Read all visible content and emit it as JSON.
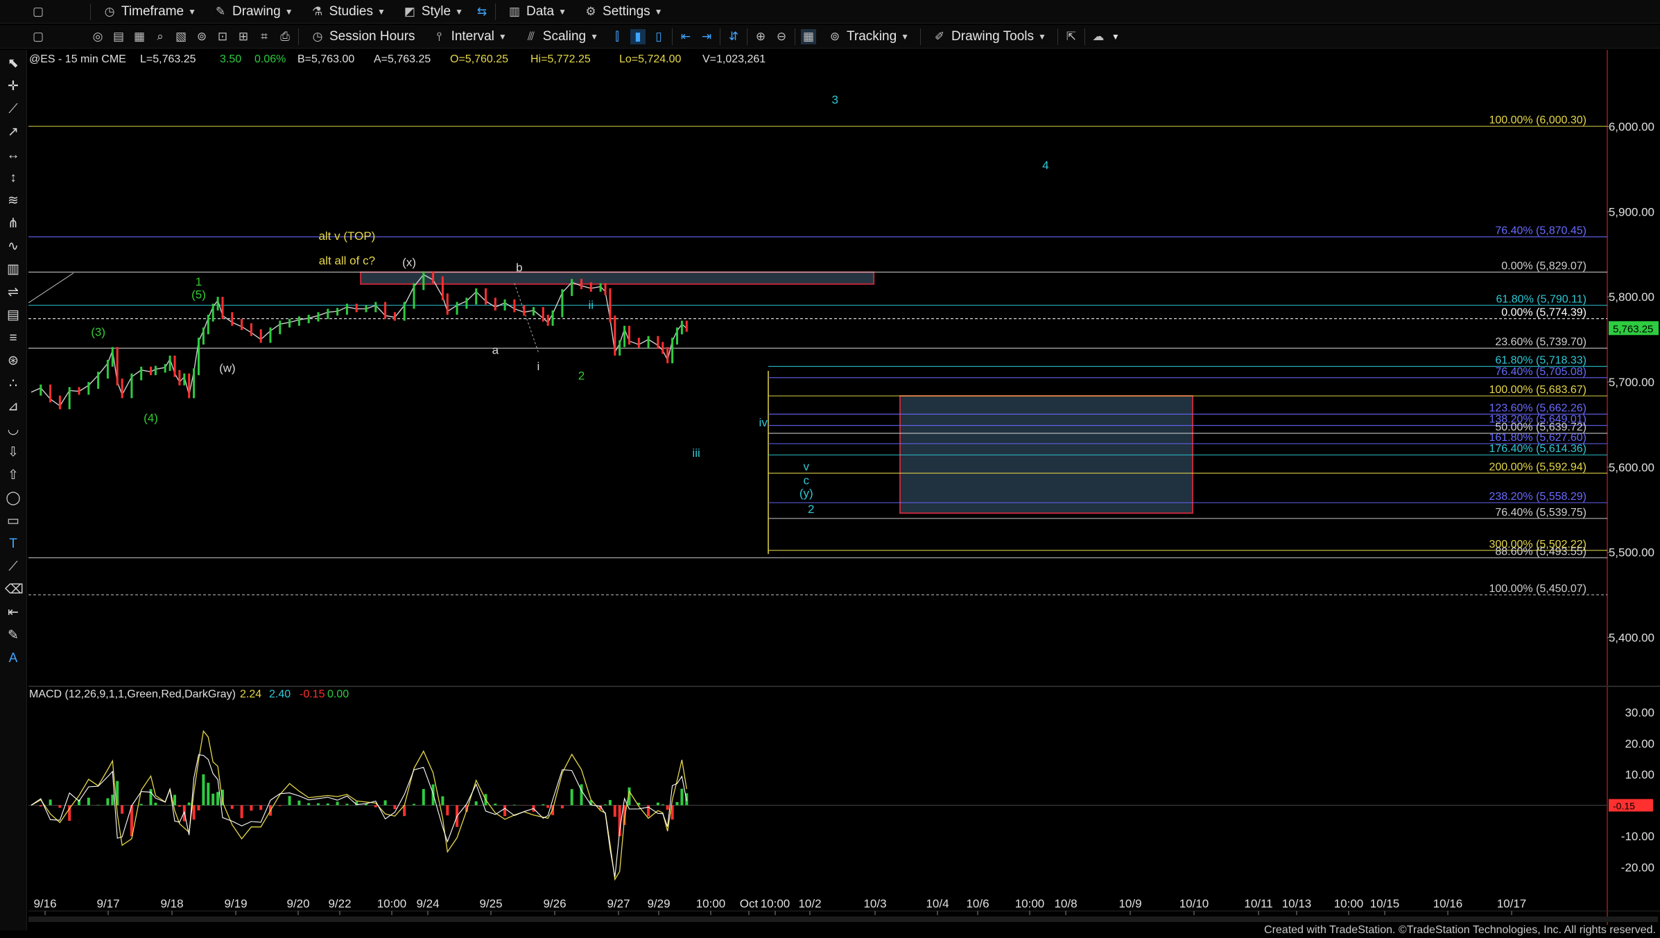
{
  "toolbar1": [
    {
      "name": "timeframe-menu",
      "icon": "clock-icon",
      "label": "Timeframe"
    },
    {
      "name": "drawing-menu",
      "icon": "pencil-icon",
      "label": "Drawing"
    },
    {
      "name": "studies-menu",
      "icon": "flask-icon",
      "label": "Studies"
    },
    {
      "name": "style-menu",
      "icon": "style-icon",
      "label": "Style"
    },
    {
      "name": "data-menu",
      "icon": "chart-icon",
      "label": "Data"
    },
    {
      "name": "settings-menu",
      "icon": "gear-icon",
      "label": "Settings"
    }
  ],
  "toolbar2": {
    "session_label": "Session Hours",
    "interval_label": "Interval",
    "scaling_label": "Scaling",
    "tracking_label": "Tracking",
    "drawing_tools_label": "Drawing Tools"
  },
  "quote_line": {
    "symbol": "@ES - 15 min  CME",
    "last": "L=5,763.25",
    "chg": "3.50",
    "pct": "0.06%",
    "bid": "B=5,763.00",
    "ask": "A=5,763.25",
    "open": "O=5,760.25",
    "high": "Hi=5,772.25",
    "low": "Lo=5,724.00",
    "vol": "V=1,023,261"
  },
  "macd_label": {
    "name": "MACD (12,26,9,1,1,Green,Red,DarkGray)",
    "v1": "2.24",
    "v2": "2.40",
    "v3": "-0.15",
    "v4": "0.00"
  },
  "footer_text": "Created with TradeStation. ©TradeStation Technologies, Inc. All rights reserved.",
  "colors": {
    "up": "#2ecc40",
    "down": "#ff3030",
    "yellow": "#e6d84a",
    "cyan": "#2fc9d6",
    "blue": "#6a6aff",
    "green_label": "#33cc33",
    "white_label": "#d8d8d8"
  },
  "chart_data": {
    "type": "line",
    "symbol": "@ES",
    "interval": "15 min",
    "price_ticks": [
      "6,000.00",
      "5,900.00",
      "5,800.00",
      "5,700.00",
      "5,600.00",
      "5,500.00",
      "5,400.00"
    ],
    "price_tick_values": [
      6000,
      5900,
      5800,
      5700,
      5600,
      5500,
      5400
    ],
    "ylim": [
      5345,
      6090
    ],
    "last_price_badge": "5,763.25",
    "time_ticks": [
      "9/16",
      "9/17",
      "9/18",
      "9/19",
      "9/20",
      "9/22",
      "10:00",
      "9/24",
      "9/25",
      "9/26",
      "9/27",
      "9/29",
      "10:00",
      "Oct",
      "10:00",
      "10/2",
      "10/3",
      "10/4",
      "10/6",
      "10:00",
      "10/8",
      "10/9",
      "10/10",
      "10/11",
      "10/13",
      "10:00",
      "10/15",
      "10/16",
      "10/17"
    ],
    "price_path": [
      [
        0,
        5688
      ],
      [
        2,
        5693
      ],
      [
        4,
        5680
      ],
      [
        6,
        5672
      ],
      [
        8,
        5690
      ],
      [
        10,
        5689
      ],
      [
        12,
        5696
      ],
      [
        14,
        5708
      ],
      [
        16,
        5722
      ],
      [
        17,
        5737
      ],
      [
        18,
        5700
      ],
      [
        19,
        5685
      ],
      [
        21,
        5706
      ],
      [
        23,
        5714
      ],
      [
        25,
        5712
      ],
      [
        26,
        5715
      ],
      [
        28,
        5717
      ],
      [
        29,
        5727
      ],
      [
        30,
        5710
      ],
      [
        31,
        5700
      ],
      [
        32,
        5706
      ],
      [
        33,
        5685
      ],
      [
        34,
        5712
      ],
      [
        35,
        5748
      ],
      [
        36,
        5760
      ],
      [
        37,
        5775
      ],
      [
        38,
        5788
      ],
      [
        39,
        5796
      ],
      [
        40,
        5778
      ],
      [
        42,
        5770
      ],
      [
        44,
        5765
      ],
      [
        46,
        5758
      ],
      [
        48,
        5750
      ],
      [
        50,
        5760
      ],
      [
        52,
        5768
      ],
      [
        54,
        5770
      ],
      [
        56,
        5773
      ],
      [
        58,
        5775
      ],
      [
        60,
        5778
      ],
      [
        62,
        5782
      ],
      [
        64,
        5783
      ],
      [
        66,
        5788
      ],
      [
        68,
        5786
      ],
      [
        70,
        5786
      ],
      [
        72,
        5790
      ],
      [
        74,
        5778
      ],
      [
        76,
        5776
      ],
      [
        78,
        5790
      ],
      [
        80,
        5812
      ],
      [
        82,
        5826
      ],
      [
        84,
        5820
      ],
      [
        86,
        5800
      ],
      [
        87,
        5783
      ],
      [
        89,
        5790
      ],
      [
        91,
        5795
      ],
      [
        93,
        5806
      ],
      [
        95,
        5795
      ],
      [
        97,
        5788
      ],
      [
        99,
        5793
      ],
      [
        101,
        5786
      ],
      [
        103,
        5782
      ],
      [
        105,
        5784
      ],
      [
        107,
        5775
      ],
      [
        108,
        5770
      ],
      [
        109,
        5780
      ],
      [
        111,
        5805
      ],
      [
        113,
        5817
      ],
      [
        115,
        5813
      ],
      [
        117,
        5810
      ],
      [
        119,
        5812
      ],
      [
        120,
        5806
      ],
      [
        121,
        5774
      ],
      [
        122,
        5735
      ],
      [
        123,
        5745
      ],
      [
        124,
        5762
      ],
      [
        125,
        5748
      ],
      [
        127,
        5744
      ],
      [
        129,
        5750
      ],
      [
        131,
        5743
      ],
      [
        132,
        5737
      ],
      [
        133,
        5726
      ],
      [
        134,
        5748
      ],
      [
        135,
        5760
      ],
      [
        136,
        5768
      ],
      [
        137,
        5763
      ]
    ],
    "price_path_x_note": "bar index",
    "fib_levels": [
      {
        "label": "100.00% (6,000.30)",
        "value": 6000.3,
        "color": "#e6d84a"
      },
      {
        "label": "76.40% (5,870.45)",
        "value": 5870.45,
        "color": "#6a6aff"
      },
      {
        "label": "0.00% (5,829.07)",
        "value": 5829.07,
        "color": "#d0d0d0"
      },
      {
        "label": "61.80% (5,790.11)",
        "value": 5790.11,
        "color": "#2fc9d6"
      },
      {
        "label": "0.00% (5,774.39)",
        "value": 5774.39,
        "color": "#ffffff"
      },
      {
        "label": "23.60% (5,739.70)",
        "value": 5739.7,
        "color": "#d0d0d0"
      },
      {
        "label": "61.80% (5,718.33)",
        "value": 5718.33,
        "color": "#2fc9d6"
      },
      {
        "label": "76.40% (5,705.08)",
        "value": 5705.08,
        "color": "#6a6aff"
      },
      {
        "label": "100.00% (5,683.67)",
        "value": 5683.67,
        "color": "#e6d84a"
      },
      {
        "label": "123.60% (5,662.26)",
        "value": 5662.26,
        "color": "#6a6aff"
      },
      {
        "label": "138.20% (5,649.01)",
        "value": 5649.01,
        "color": "#6a6aff"
      },
      {
        "label": "50.00% (5,639.72)",
        "value": 5639.72,
        "color": "#d0d0d0"
      },
      {
        "label": "161.80% (5,627.60)",
        "value": 5627.6,
        "color": "#6a6aff"
      },
      {
        "label": "176.40% (5,614.36)",
        "value": 5614.36,
        "color": "#2fc9d6"
      },
      {
        "label": "200.00% (5,592.94)",
        "value": 5592.94,
        "color": "#e6d84a"
      },
      {
        "label": "238.20% (5,558.29)",
        "value": 5558.29,
        "color": "#6a6aff"
      },
      {
        "label": "76.40% (5,539.75)",
        "value": 5539.75,
        "color": "#d0d0d0"
      },
      {
        "label": "300.00% (5,502.22)",
        "value": 5502.22,
        "color": "#e6d84a"
      },
      {
        "label": "88.60% (5,493.55)",
        "value": 5493.55,
        "color": "#d0d0d0"
      },
      {
        "label": "100.00% (5,450.07)",
        "value": 5450.07,
        "color": "#d0d0d0"
      }
    ],
    "wave_labels": [
      {
        "text": "(3)",
        "bar": 14,
        "price": 5754,
        "color": "#33cc33"
      },
      {
        "text": "(4)",
        "bar": 25,
        "price": 5653,
        "color": "#33cc33"
      },
      {
        "text": "1",
        "bar": 35,
        "price": 5813,
        "color": "#33cc33"
      },
      {
        "text": "(5)",
        "bar": 35,
        "price": 5798,
        "color": "#33cc33"
      },
      {
        "text": "(w)",
        "bar": 41,
        "price": 5712,
        "color": "#d8d8d8"
      },
      {
        "text": "alt v (TOP)",
        "bar": 66,
        "price": 5867,
        "color": "#e6d84a"
      },
      {
        "text": "alt all of c?",
        "bar": 66,
        "price": 5838,
        "color": "#e6d84a"
      },
      {
        "text": "(x)",
        "bar": 79,
        "price": 5836,
        "color": "#d8d8d8"
      },
      {
        "text": "b",
        "bar": 102,
        "price": 5830,
        "color": "#d8d8d8"
      },
      {
        "text": "a",
        "bar": 97,
        "price": 5733,
        "color": "#d8d8d8"
      },
      {
        "text": "i",
        "bar": 106,
        "price": 5714,
        "color": "#d8d8d8"
      },
      {
        "text": "ii",
        "bar": 117,
        "price": 5786,
        "color": "#2fc9d6"
      },
      {
        "text": "2",
        "bar": 115,
        "price": 5703,
        "color": "#33cc33"
      },
      {
        "text": "3",
        "bar": 168,
        "price": 6027,
        "color": "#2fc9d6"
      },
      {
        "text": "4",
        "bar": 212,
        "price": 5950,
        "color": "#2fc9d6"
      },
      {
        "text": "iii",
        "bar": 139,
        "price": 5612,
        "color": "#2fc9d6"
      },
      {
        "text": "iv",
        "bar": 153,
        "price": 5648,
        "color": "#2fc9d6"
      },
      {
        "text": "v",
        "bar": 162,
        "price": 5596,
        "color": "#2fc9d6"
      },
      {
        "text": "c",
        "bar": 162,
        "price": 5580,
        "color": "#2fc9d6"
      },
      {
        "text": "(y)",
        "bar": 162,
        "price": 5565,
        "color": "#2fc9d6"
      },
      {
        "text": "2",
        "bar": 163,
        "price": 5546,
        "color": "#2fc9d6"
      }
    ],
    "macd": {
      "ylim": [
        -27,
        38
      ],
      "ticks": [
        "30.00",
        "20.00",
        "10.00",
        "-10.00",
        "-20.00"
      ],
      "tick_values": [
        30,
        20,
        10,
        -10,
        -20
      ],
      "badge": "-0.15"
    }
  }
}
